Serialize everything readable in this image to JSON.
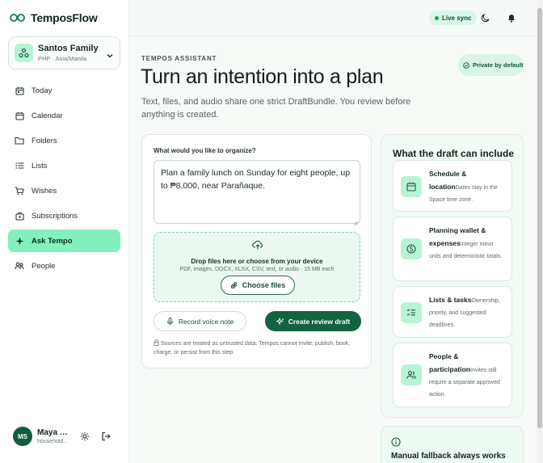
{
  "app": {
    "name": "TemposFlow"
  },
  "household": {
    "name": "Santos Family",
    "meta": "PHP · Asia/Manila"
  },
  "nav": [
    {
      "label": "Today",
      "icon": "calendar-day-icon"
    },
    {
      "label": "Calendar",
      "icon": "calendar-icon"
    },
    {
      "label": "Folders",
      "icon": "folder-icon"
    },
    {
      "label": "Lists",
      "icon": "list-icon"
    },
    {
      "label": "Wishes",
      "icon": "cart-icon"
    },
    {
      "label": "Subscriptions",
      "icon": "subscriptions-icon"
    },
    {
      "label": "Ask Tempo",
      "icon": "sparkle-icon",
      "active": true
    },
    {
      "label": "People",
      "icon": "people-icon"
    }
  ],
  "profile": {
    "initials": "MS",
    "name": "Maya Santos",
    "role": "household owner"
  },
  "topbar": {
    "sync_label": "Live sync"
  },
  "main": {
    "eyebrow": "TEMPOS ASSISTANT",
    "private_badge": "Private by default",
    "headline": "Turn an intention into a plan",
    "subtitle": "Text, files, and audio share one strict DraftBundle. You review before anything is created."
  },
  "compose": {
    "label": "What would you like to organize?",
    "value": "Plan a family lunch on Sunday for eight people, up to ₱8,000, near Parañaque.",
    "dropzone_title": "Drop files here or choose from your device",
    "dropzone_sub": "PDF, images, DOCX, XLSX, CSV, text, or audio · 15 MB each",
    "choose_label": "Choose files",
    "voice_label": "Record voice note",
    "create_label": "Create review draft",
    "disclaimer": "Sources are treated as untrusted data. Tempos cannot invite, publish, book, charge, or persist from this step."
  },
  "includes": {
    "title": "What the draft can include",
    "items": [
      {
        "title": "Schedule & location",
        "desc": "Dates stay in the Space time zone.",
        "icon": "calendar-icon"
      },
      {
        "title": "Planning wallet & expenses",
        "desc": "Integer minor units and deterministic totals.",
        "icon": "wallet-icon"
      },
      {
        "title": "Lists & tasks",
        "desc": "Ownership, priority, and suggested deadlines.",
        "icon": "checklist-icon"
      },
      {
        "title": "People & participation",
        "desc": "Invites still require a separate approved action.",
        "icon": "people-icon"
      }
    ]
  },
  "fallback": {
    "title": "Manual fallback always works"
  },
  "colors": {
    "accent": "#126340",
    "active_nav": "#86efc0",
    "mint": "#baf2d6"
  }
}
